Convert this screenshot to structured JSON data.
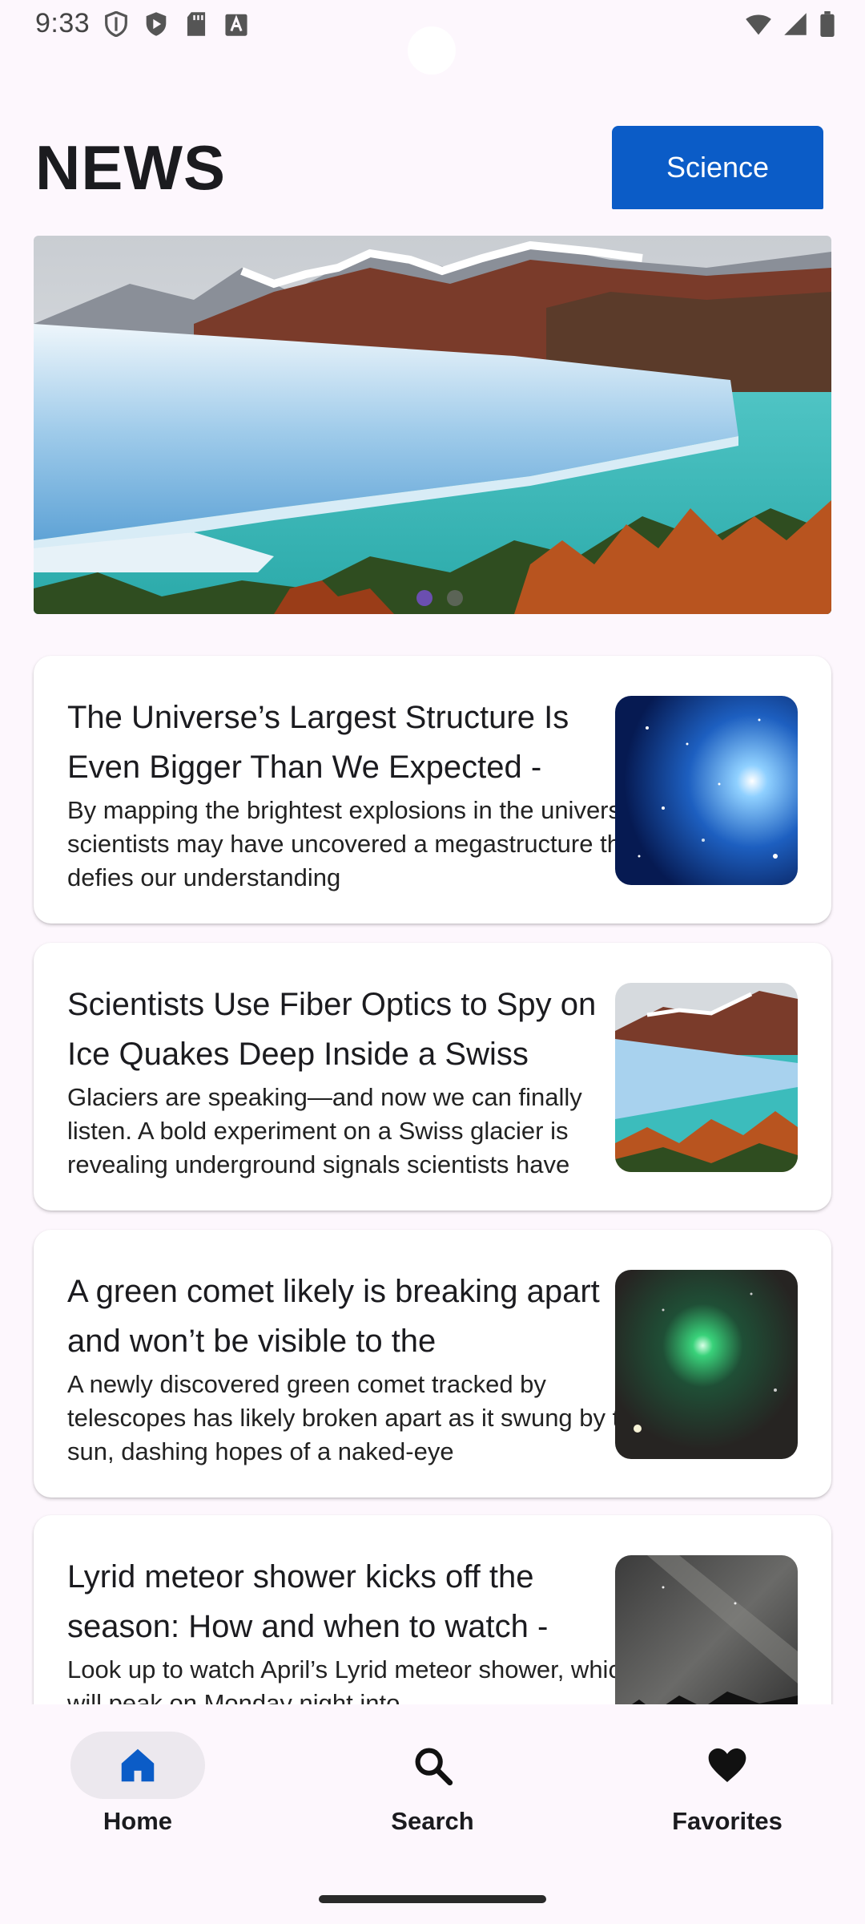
{
  "status_bar": {
    "time": "9:33"
  },
  "header": {
    "title": "NEWS",
    "category_button": "Science"
  },
  "carousel": {
    "slide_count": 2,
    "active_index": 0
  },
  "articles": [
    {
      "title": "The Universe’s Largest Structure Is Even Bigger Than We Expected -",
      "description": "By mapping the brightest explosions in the universe, scientists may have uncovered a megastructure that defies our understanding"
    },
    {
      "title": "Scientists Use Fiber Optics to Spy on Ice Quakes Deep Inside a Swiss",
      "description": "Glaciers are speaking—and now we can finally listen. A bold experiment on a Swiss glacier is revealing underground signals scientists have"
    },
    {
      "title": "A green comet likely is breaking apart and won’t be visible to the",
      "description": "A newly discovered green comet tracked by telescopes has likely broken apart as it swung by the sun, dashing hopes of a naked-eye"
    },
    {
      "title": "Lyrid meteor shower kicks off the season: How and when to watch -",
      "description": "Look up to watch April’s Lyrid meteor shower, which will peak on Monday night into"
    }
  ],
  "bottom_nav": {
    "items": [
      {
        "label": "Home",
        "icon": "home-icon",
        "active": true
      },
      {
        "label": "Search",
        "icon": "search-icon",
        "active": false
      },
      {
        "label": "Favorites",
        "icon": "heart-icon",
        "active": false
      }
    ]
  },
  "colors": {
    "accent": "#0b5cc7",
    "background": "#fdf7fd",
    "active_dot": "#6b4fb0"
  }
}
